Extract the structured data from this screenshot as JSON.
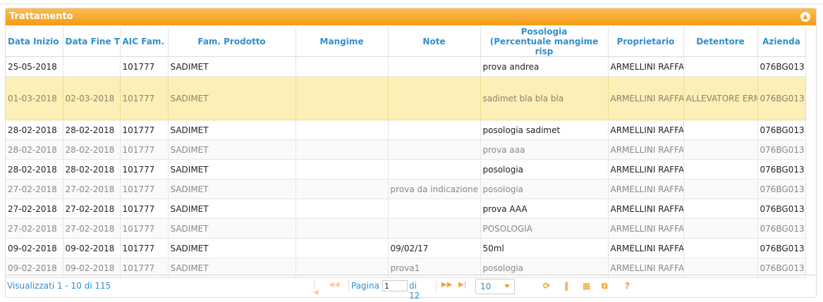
{
  "panel": {
    "title": "Trattamento"
  },
  "columns": [
    "Data Inizio",
    "Data Fine T",
    "AIC Fam.",
    "Fam. Prodotto",
    "Mangime",
    "Note",
    "Posologia\n(Percentuale mangime risp",
    "Proprietario",
    "Detentore",
    "Azienda"
  ],
  "rows": [
    [
      "25-05-2018",
      "",
      "101777",
      "SADIMET",
      "",
      "",
      "prova andrea",
      "ARMELLINI RAFFA",
      "",
      "076BG013"
    ],
    [
      "01-03-2018",
      "02-03-2018",
      "101777",
      "SADIMET",
      "",
      "",
      "sadimet bla bla bla",
      "ARMELLINI RAFFA",
      "ALLEVATORE ERM",
      "076BG013"
    ],
    [
      "28-02-2018",
      "28-02-2018",
      "101777",
      "SADIMET",
      "",
      "",
      "posologia sadimet",
      "ARMELLINI RAFFA",
      "",
      "076BG013"
    ],
    [
      "28-02-2018",
      "28-02-2018",
      "101777",
      "SADIMET",
      "",
      "",
      "prova aaa",
      "ARMELLINI RAFFA",
      "",
      "076BG013"
    ],
    [
      "28-02-2018",
      "28-02-2018",
      "101777",
      "SADIMET",
      "",
      "",
      "posologia",
      "ARMELLINI RAFFA",
      "",
      "076BG013"
    ],
    [
      "27-02-2018",
      "27-02-2018",
      "101777",
      "SADIMET",
      "",
      "prova da indicazione",
      "posologia",
      "ARMELLINI RAFFA",
      "",
      "076BG013"
    ],
    [
      "27-02-2018",
      "27-02-2018",
      "101777",
      "SADIMET",
      "",
      "",
      "prova AAA",
      "ARMELLINI RAFFA",
      "",
      "076BG013"
    ],
    [
      "27-02-2018",
      "27-02-2018",
      "101777",
      "SADIMET",
      "",
      "",
      "POSOLOGIA",
      "ARMELLINI RAFFA",
      "",
      "076BG013"
    ],
    [
      "09-02-2018",
      "09-02-2018",
      "101777",
      "SADIMET",
      "",
      "09/02/17",
      "50ml",
      "ARMELLINI RAFFA",
      "",
      "076BG013"
    ],
    [
      "09-02-2018",
      "09-02-2018",
      "101777",
      "SADIMET",
      "",
      "prova1",
      "posologia",
      "ARMELLINI RAFFA",
      "",
      "076BG013"
    ]
  ],
  "selected_row": 1,
  "pager": {
    "records_text": "Visualizzati 1 - 10 di 115",
    "page_label": "Pagina",
    "page_value": "1",
    "of_label": "di 12",
    "page_size": "10"
  },
  "icons": {
    "first": "first-page-icon",
    "prev": "prev-page-icon",
    "next": "next-page-icon",
    "last": "last-page-icon",
    "refresh": "refresh-icon",
    "columns": "columns-icon",
    "export": "export-icon",
    "popout": "popout-icon",
    "help": "help-icon"
  },
  "colors": {
    "accent": "#f59a16",
    "link": "#2f8fcf",
    "selected": "#fcefb8"
  }
}
